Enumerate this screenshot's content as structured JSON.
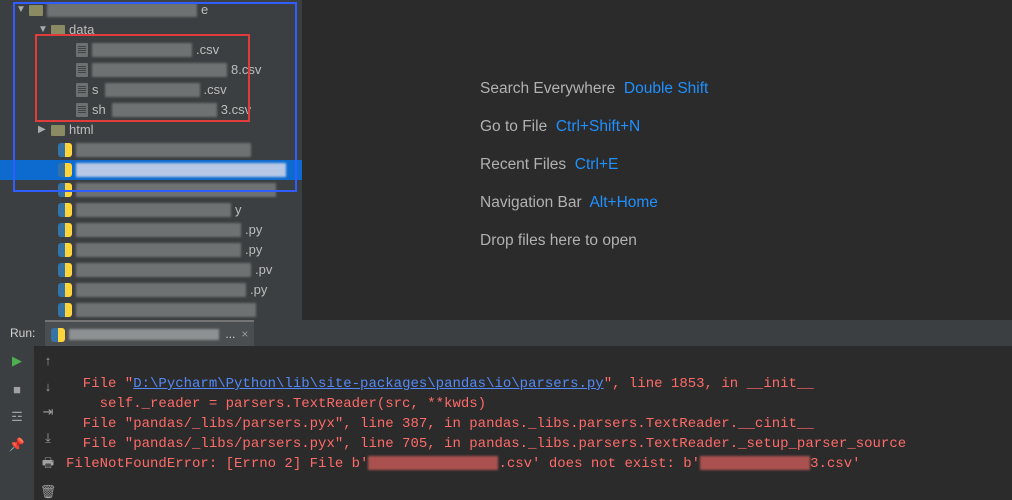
{
  "tree": {
    "root_label": "e",
    "data_folder": "data",
    "files": [
      ".csv",
      "8.csv",
      ".csv",
      "3.csv"
    ],
    "html_folder": "html",
    "py_suffixes": [
      "",
      "",
      "y",
      ".py",
      ".py",
      ".pv",
      ".py"
    ]
  },
  "hints": {
    "search": {
      "label": "Search Everywhere",
      "key": "Double Shift"
    },
    "gotofile": {
      "label": "Go to File",
      "key": "Ctrl+Shift+N"
    },
    "recent": {
      "label": "Recent Files",
      "key": "Ctrl+E"
    },
    "navbar": {
      "label": "Navigation Bar",
      "key": "Alt+Home"
    },
    "drop": {
      "label": "Drop files here to open"
    }
  },
  "run": {
    "title": "Run:",
    "tab_ext": "...",
    "lines": [
      {
        "prefix": "  File \"",
        "link": "D:\\Pycharm\\Python\\lib\\site-packages\\pandas\\io\\parsers.py",
        "suffix": "\", line 1853, in __init__"
      },
      {
        "text": "    self._reader = parsers.TextReader(src, **kwds)"
      },
      {
        "text": "  File \"pandas/_libs/parsers.pyx\", line 387, in pandas._libs.parsers.TextReader.__cinit__"
      },
      {
        "text": "  File \"pandas/_libs/parsers.pyx\", line 705, in pandas._libs.parsers.TextReader._setup_parser_source"
      },
      {
        "err_a": "FileNotFoundError: [Errno 2] File b'",
        "err_b": ".csv' does not exist: b'",
        "err_c": "3.csv'"
      }
    ]
  }
}
